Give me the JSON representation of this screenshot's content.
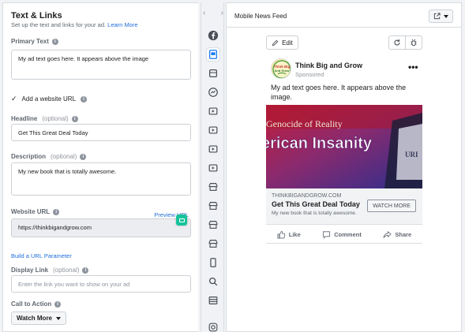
{
  "editor": {
    "section_title": "Text & Links",
    "section_subtitle": "Set up the text and links for your ad.",
    "learn_more": "Learn More",
    "primary_text": {
      "label": "Primary Text",
      "value": "My ad text goes here.  It appears above the image"
    },
    "website_url_toggle": {
      "label": "Add a website URL",
      "checked": true
    },
    "headline": {
      "label": "Headline",
      "optional": "(optional)",
      "value": "Get This Great Deal Today"
    },
    "description": {
      "label": "Description",
      "optional": "(optional)",
      "value": "My new book that is totally awesome."
    },
    "website_url": {
      "label": "Website URL",
      "preview_link": "Preview URL",
      "value": "https://thinkbigandgrow.com"
    },
    "url_parameter_link": "Build a URL Parameter",
    "display_link": {
      "label": "Display Link",
      "optional": "(optional)",
      "placeholder": "Enter the link you want to show on your ad"
    },
    "call_to_action": {
      "label": "Call to Action",
      "selected": "Watch More"
    }
  },
  "placement_strip": {
    "nav_prev": "‹",
    "nav_next": "›",
    "icons": [
      "facebook-icon",
      "mobile-feed-icon",
      "desktop-feed-icon",
      "messenger-icon",
      "video-icon",
      "video-icon",
      "video-icon",
      "video-icon",
      "marketplace-icon",
      "marketplace-icon",
      "marketplace-icon",
      "marketplace-icon",
      "phone-icon",
      "search-icon",
      "store-icon",
      "instagram-icon"
    ]
  },
  "preview": {
    "title": "Mobile News Feed",
    "edit_label": "Edit",
    "page_name": "Think Big and Grow",
    "avatar_text": "Think Big And Grow",
    "sponsored_label": "Sponsored",
    "post_text": "My ad text goes here.  It appears above the image.",
    "ad_image": {
      "line1": "Genocide of Reality",
      "line2": "erican Insanity",
      "line3": "URI"
    },
    "ad_domain": "THINKBIGANDGROW.COM",
    "ad_headline": "Get This Great Deal Today",
    "ad_description": "My new book that is totally awesome.",
    "ad_cta": "WATCH MORE",
    "actions": {
      "like": "Like",
      "comment": "Comment",
      "share": "Share"
    }
  },
  "colors": {
    "link_blue": "#216fdb",
    "grammarly_green": "#15c39a",
    "border": "#dadde1"
  }
}
